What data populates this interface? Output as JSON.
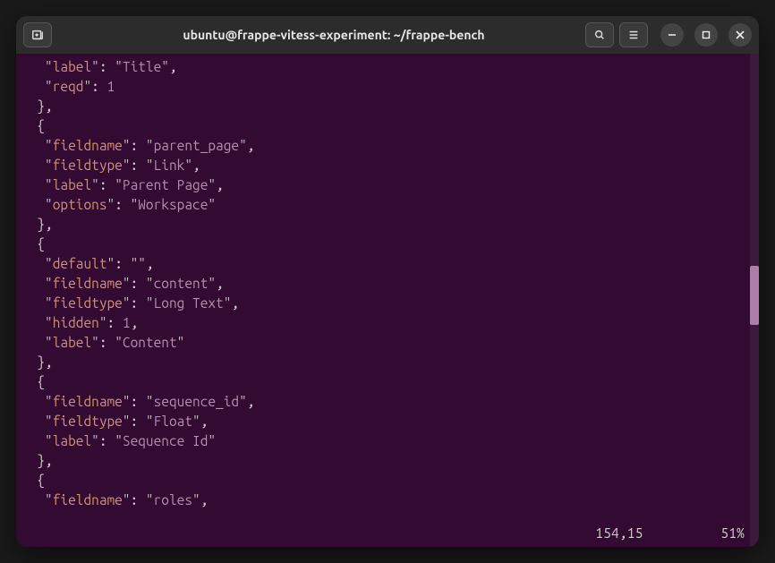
{
  "window": {
    "title": "ubuntu@frappe-vitess-experiment: ~/frappe-bench"
  },
  "status": {
    "position": "154,15",
    "percent": "51%"
  },
  "scrollbar": {
    "top_pct": 43,
    "height_pct": 12
  },
  "code_lines": [
    {
      "indent": 3,
      "tokens": [
        {
          "t": "key",
          "v": "label"
        },
        {
          "t": "colon"
        },
        {
          "t": "str",
          "v": "Title"
        },
        {
          "t": "comma"
        }
      ]
    },
    {
      "indent": 3,
      "tokens": [
        {
          "t": "key",
          "v": "reqd"
        },
        {
          "t": "colon"
        },
        {
          "t": "num",
          "v": "1"
        }
      ]
    },
    {
      "indent": 2,
      "tokens": [
        {
          "t": "plain",
          "v": "},"
        }
      ]
    },
    {
      "indent": 2,
      "tokens": [
        {
          "t": "plain",
          "v": "{"
        }
      ]
    },
    {
      "indent": 3,
      "tokens": [
        {
          "t": "key",
          "v": "fieldname"
        },
        {
          "t": "colon"
        },
        {
          "t": "str",
          "v": "parent_page"
        },
        {
          "t": "comma"
        }
      ]
    },
    {
      "indent": 3,
      "tokens": [
        {
          "t": "key",
          "v": "fieldtype"
        },
        {
          "t": "colon"
        },
        {
          "t": "str",
          "v": "Link"
        },
        {
          "t": "comma"
        }
      ]
    },
    {
      "indent": 3,
      "tokens": [
        {
          "t": "key",
          "v": "label"
        },
        {
          "t": "colon"
        },
        {
          "t": "str",
          "v": "Parent Page"
        },
        {
          "t": "comma"
        }
      ]
    },
    {
      "indent": 3,
      "tokens": [
        {
          "t": "key",
          "v": "options"
        },
        {
          "t": "colon"
        },
        {
          "t": "str",
          "v": "Workspace"
        }
      ]
    },
    {
      "indent": 2,
      "tokens": [
        {
          "t": "plain",
          "v": "},"
        }
      ]
    },
    {
      "indent": 2,
      "tokens": [
        {
          "t": "plain",
          "v": "{"
        }
      ]
    },
    {
      "indent": 3,
      "tokens": [
        {
          "t": "key",
          "v": "default"
        },
        {
          "t": "colon"
        },
        {
          "t": "str",
          "v": ""
        },
        {
          "t": "comma"
        }
      ]
    },
    {
      "indent": 3,
      "tokens": [
        {
          "t": "key",
          "v": "fieldname"
        },
        {
          "t": "colon"
        },
        {
          "t": "str",
          "v": "content"
        },
        {
          "t": "comma"
        }
      ]
    },
    {
      "indent": 3,
      "tokens": [
        {
          "t": "key",
          "v": "fieldtype"
        },
        {
          "t": "colon"
        },
        {
          "t": "str",
          "v": "Long Text"
        },
        {
          "t": "comma"
        }
      ]
    },
    {
      "indent": 3,
      "tokens": [
        {
          "t": "key",
          "v": "hidden"
        },
        {
          "t": "colon"
        },
        {
          "t": "num",
          "v": "1"
        },
        {
          "t": "comma"
        }
      ]
    },
    {
      "indent": 3,
      "tokens": [
        {
          "t": "key",
          "v": "label"
        },
        {
          "t": "colon"
        },
        {
          "t": "str",
          "v": "Content"
        }
      ]
    },
    {
      "indent": 2,
      "tokens": [
        {
          "t": "plain",
          "v": "},"
        }
      ]
    },
    {
      "indent": 2,
      "tokens": [
        {
          "t": "plain",
          "v": "{"
        }
      ]
    },
    {
      "indent": 3,
      "tokens": [
        {
          "t": "key",
          "v": "fieldname"
        },
        {
          "t": "colon"
        },
        {
          "t": "str",
          "v": "sequence_id"
        },
        {
          "t": "comma"
        }
      ]
    },
    {
      "indent": 3,
      "tokens": [
        {
          "t": "key",
          "v": "fieldtype"
        },
        {
          "t": "colon"
        },
        {
          "t": "str",
          "v": "Float"
        },
        {
          "t": "comma"
        }
      ]
    },
    {
      "indent": 3,
      "tokens": [
        {
          "t": "key",
          "v": "label"
        },
        {
          "t": "colon"
        },
        {
          "t": "str",
          "v": "Sequence Id"
        }
      ]
    },
    {
      "indent": 2,
      "tokens": [
        {
          "t": "plain",
          "v": "},"
        }
      ]
    },
    {
      "indent": 2,
      "tokens": [
        {
          "t": "plain",
          "v": "{"
        }
      ]
    },
    {
      "indent": 3,
      "tokens": [
        {
          "t": "key",
          "v": "fieldname"
        },
        {
          "t": "colon"
        },
        {
          "t": "str",
          "v": "roles"
        },
        {
          "t": "comma"
        }
      ]
    }
  ]
}
